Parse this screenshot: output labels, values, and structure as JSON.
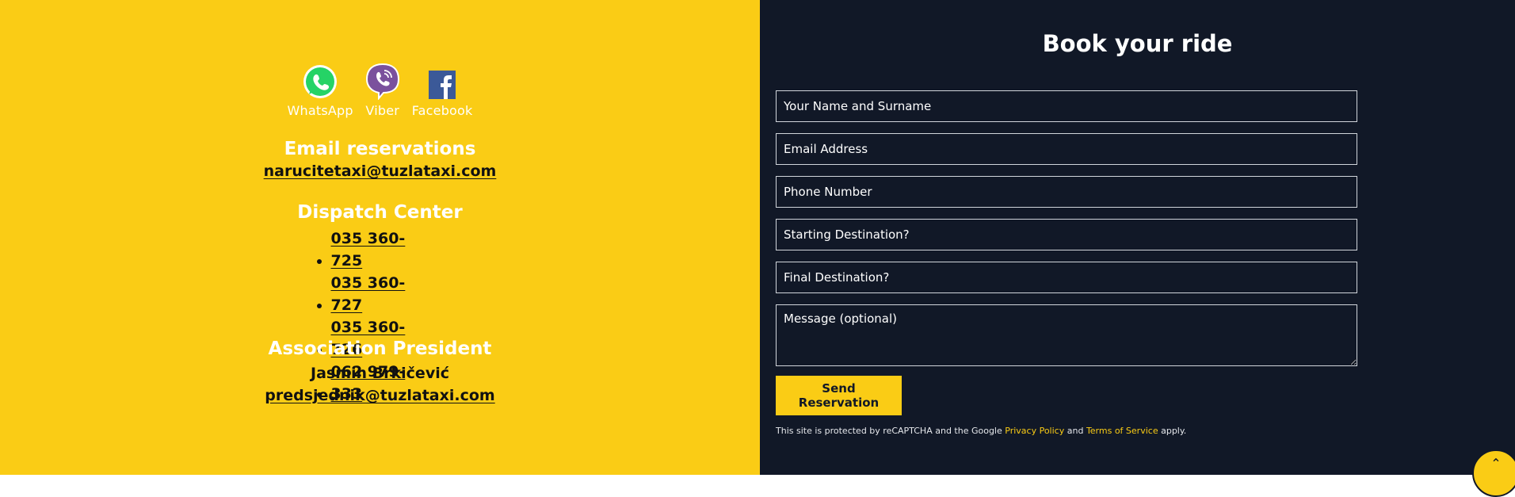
{
  "social": [
    {
      "label": "WhatsApp",
      "icon": "whatsapp-icon"
    },
    {
      "label": "Viber",
      "icon": "viber-icon"
    },
    {
      "label": "Facebook",
      "icon": "facebook-icon"
    }
  ],
  "email_reservations": {
    "heading": "Email reservations",
    "email": "narucitetaxi@tuzlataxi.com"
  },
  "dispatch": {
    "heading": "Dispatch Center",
    "phones": [
      "035 360-725",
      "035 360-727",
      "035 360-726",
      "062 979-333"
    ]
  },
  "president": {
    "heading": "Association President",
    "name": "Jasmin Brkičević",
    "email": "predsjednik@tuzlataxi.com"
  },
  "form": {
    "title": "Book your ride",
    "name_placeholder": "Your Name and Surname",
    "email_placeholder": "Email Address",
    "phone_placeholder": "Phone Number",
    "start_placeholder": "Starting Destination?",
    "final_placeholder": "Final Destination?",
    "message_placeholder": "Message (optional)",
    "submit_label": "Send Reservation"
  },
  "recaptcha": {
    "prefix": "This site is protected by reCAPTCHA and the Google",
    "privacy": "Privacy Policy",
    "and": "and",
    "terms": "Terms of Service",
    "suffix": "apply."
  },
  "colors": {
    "accent": "#facc15",
    "dark": "#111827"
  },
  "fab_icon": "chevron-up-icon"
}
